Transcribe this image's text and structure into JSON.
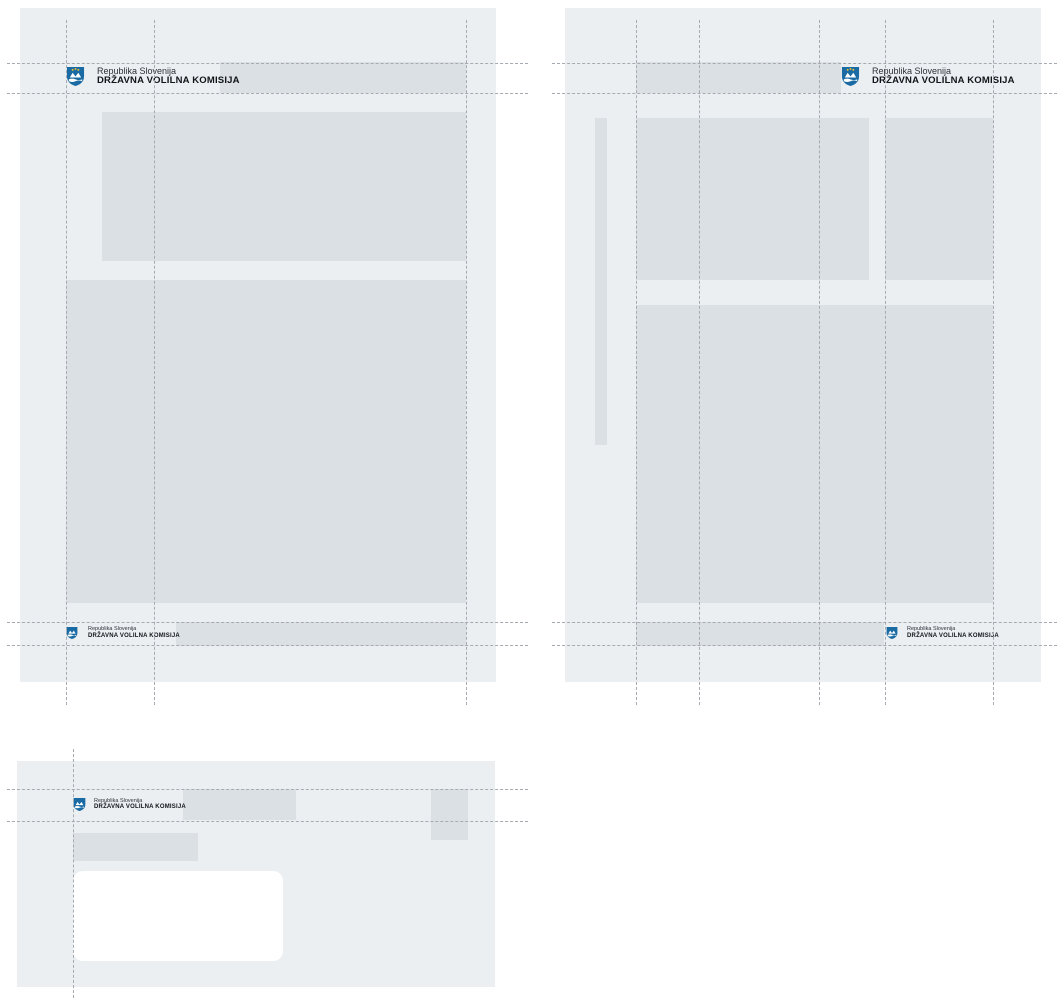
{
  "brand": {
    "line1": "Republika Slovenija",
    "line2": "DRŽAVNA VOLILNA KOMISIJA",
    "crest_icon": "slovenian-coat-of-arms-icon",
    "crest_color": "#1a6aa3"
  },
  "colors": {
    "sheet": "#ebeff2",
    "placeholder": "#dbe0e4",
    "guide": "#a5abb0"
  }
}
